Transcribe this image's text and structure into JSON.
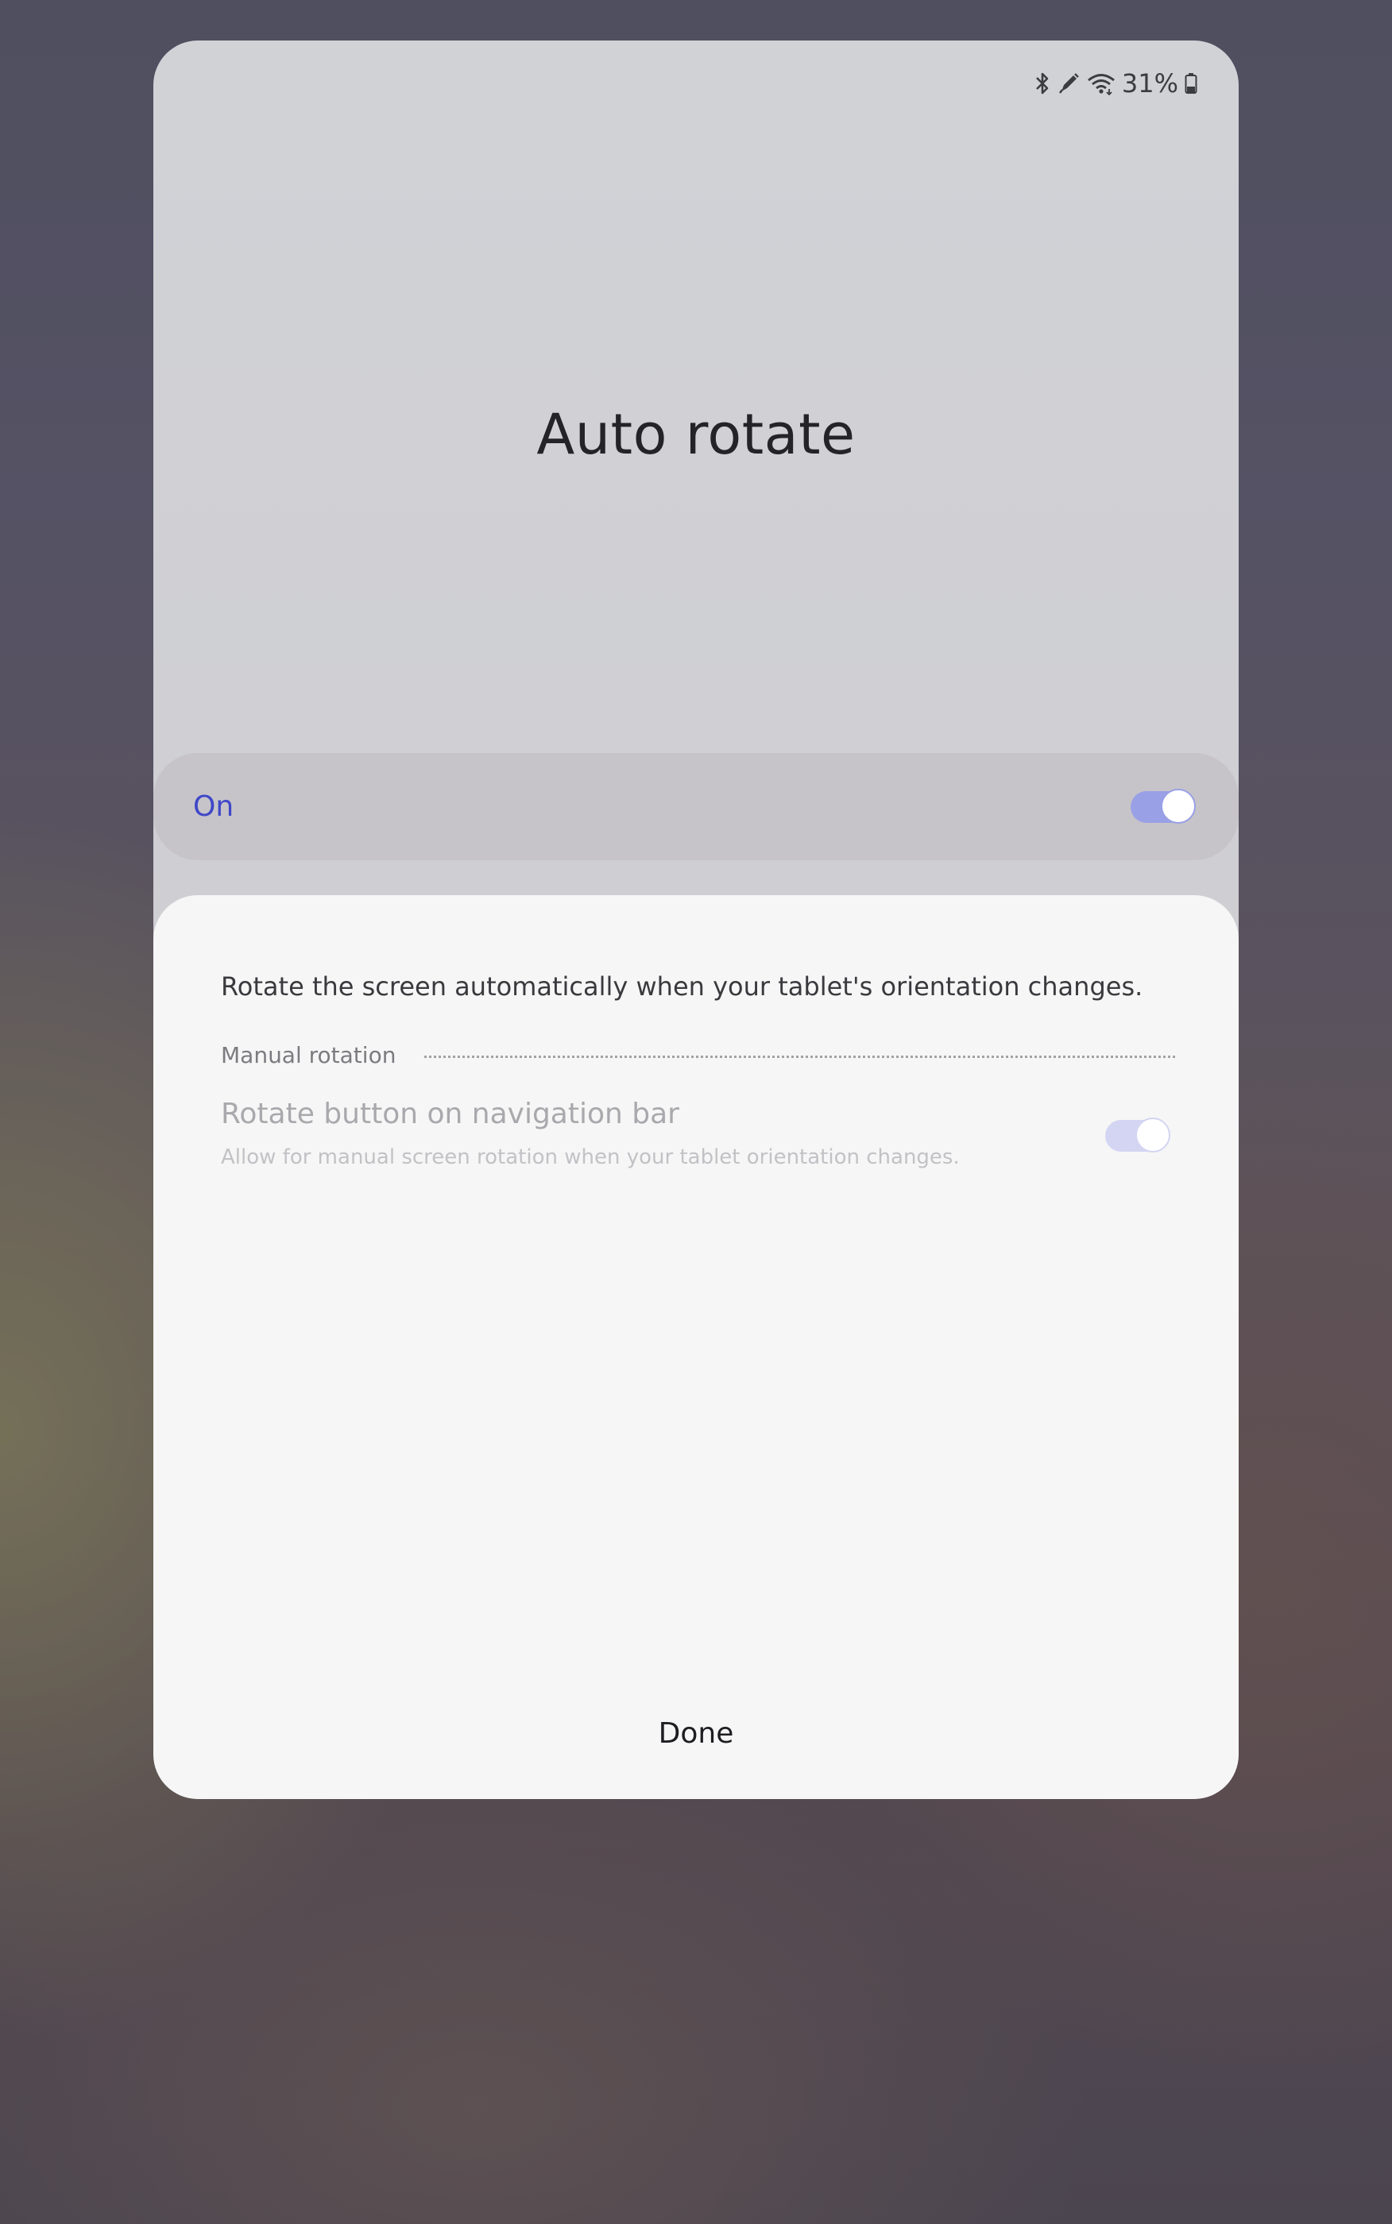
{
  "status_bar": {
    "icons": [
      "bluetooth-icon",
      "pen-icon",
      "wifi-icon",
      "battery-icon"
    ],
    "battery_text": "31%"
  },
  "header": {
    "title": "Auto rotate"
  },
  "master_toggle": {
    "label": "On",
    "state": true,
    "accent_color": "#3f47c8"
  },
  "content": {
    "description": "Rotate the screen automatically when your tablet's orientation changes.",
    "section_label": "Manual rotation",
    "nav_setting": {
      "title": "Rotate button on navigation bar",
      "subtitle": "Allow for manual screen rotation when your tablet orientation changes.",
      "state": true,
      "enabled": false
    }
  },
  "footer": {
    "done_label": "Done"
  }
}
